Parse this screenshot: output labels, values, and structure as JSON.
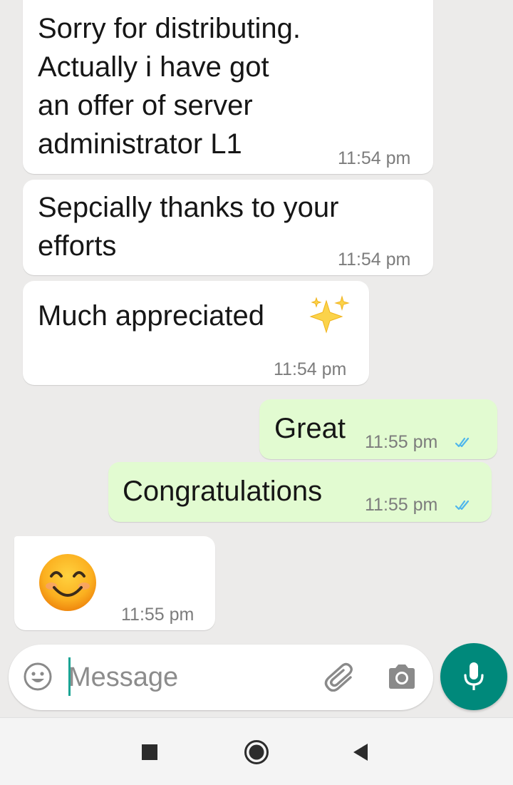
{
  "messages": [
    {
      "direction": "incoming",
      "text": "Sorry for distributing.\nActually i have got\nan offer of server\nadministrator L1",
      "time": "11:54 pm"
    },
    {
      "direction": "incoming",
      "text": "Sepcially thanks to your\nefforts",
      "time": "11:54 pm"
    },
    {
      "direction": "incoming",
      "text": "Much appreciated",
      "emoji": "sparkles-emoji",
      "time": "11:54 pm"
    },
    {
      "direction": "outgoing",
      "text": "Great",
      "time": "11:55 pm",
      "status": "read"
    },
    {
      "direction": "outgoing",
      "text": "Congratulations",
      "time": "11:55 pm",
      "status": "read"
    },
    {
      "direction": "incoming",
      "emoji": "smiling-face-emoji",
      "time": "11:55 pm"
    }
  ],
  "composer": {
    "placeholder": "Message",
    "icons": [
      "emoji-icon",
      "attach-icon",
      "camera-icon",
      "mic-icon"
    ]
  },
  "navigation": {
    "icons": [
      "recents-square-icon",
      "home-circle-icon",
      "back-triangle-icon"
    ]
  },
  "colors": {
    "background": "#ecebea",
    "incoming_bubble": "#ffffff",
    "outgoing_bubble": "#e2fbd1",
    "read_ticks": "#4fb6ec",
    "send_button": "#00897b",
    "caret": "#1aa494"
  }
}
